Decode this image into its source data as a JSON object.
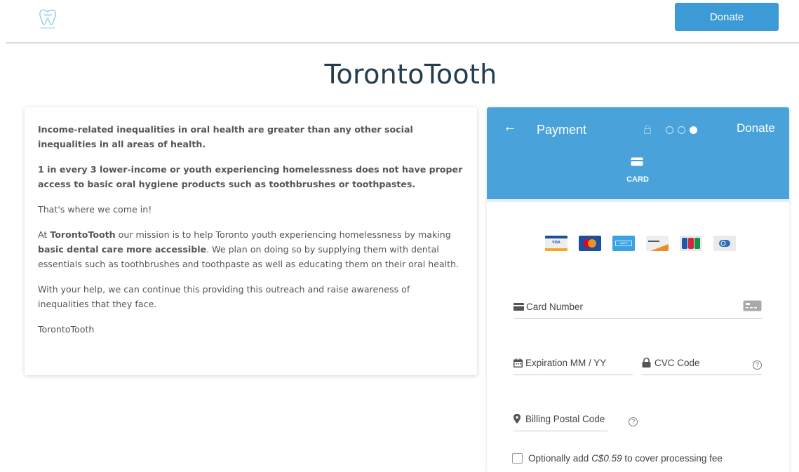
{
  "site": {
    "logo_text": "torontotooth",
    "donate_button": "Donate",
    "page_title": "TorontoTooth"
  },
  "info": {
    "p1": "Income-related inequalities in oral health are greater than any other social inequalities in all areas of health.",
    "p2": "1 in every 3 lower-income or youth experiencing homelessness does not have proper access to basic oral hygiene products such as toothbrushes or toothpastes.",
    "p3": "That's where we come in!",
    "p4_a": "At ",
    "p4_brand": "TorontoTooth",
    "p4_b": " our mission is to help Toronto youth experiencing homelessness by making ",
    "p4_bold": "basic dental care more accessible",
    "p4_c": ". We plan on doing so by supplying them with dental essentials such as toothbrushes and toothpaste as well as educating them on their oral health.",
    "p5": "With your help, we can continue this providing this outreach and raise awareness of inequalities that they face.",
    "p6": "TorontoTooth"
  },
  "payment": {
    "back_icon": "arrow-left-icon",
    "title": "Payment",
    "donate_label": "Donate",
    "steps": {
      "total": 3,
      "active_index": 3
    },
    "tab_label": "CARD",
    "brands": [
      "visa",
      "mastercard",
      "amex",
      "discover",
      "jcb",
      "diners"
    ],
    "brand_visa_text": "VISA",
    "brand_amex_text": "AMEX",
    "card_number_placeholder": "Card Number",
    "expiration_placeholder": "Expiration MM / YY",
    "cvc_placeholder": "CVC Code",
    "postal_placeholder": "Billing Postal Code",
    "help_glyph": "?",
    "fee_prefix": "Optionally add ",
    "fee_amount": "C$0.59",
    "fee_suffix": " to cover processing fee"
  },
  "colors": {
    "accent": "#49a3da",
    "donate_button": "#3c9ad6",
    "title": "#243d4f"
  }
}
